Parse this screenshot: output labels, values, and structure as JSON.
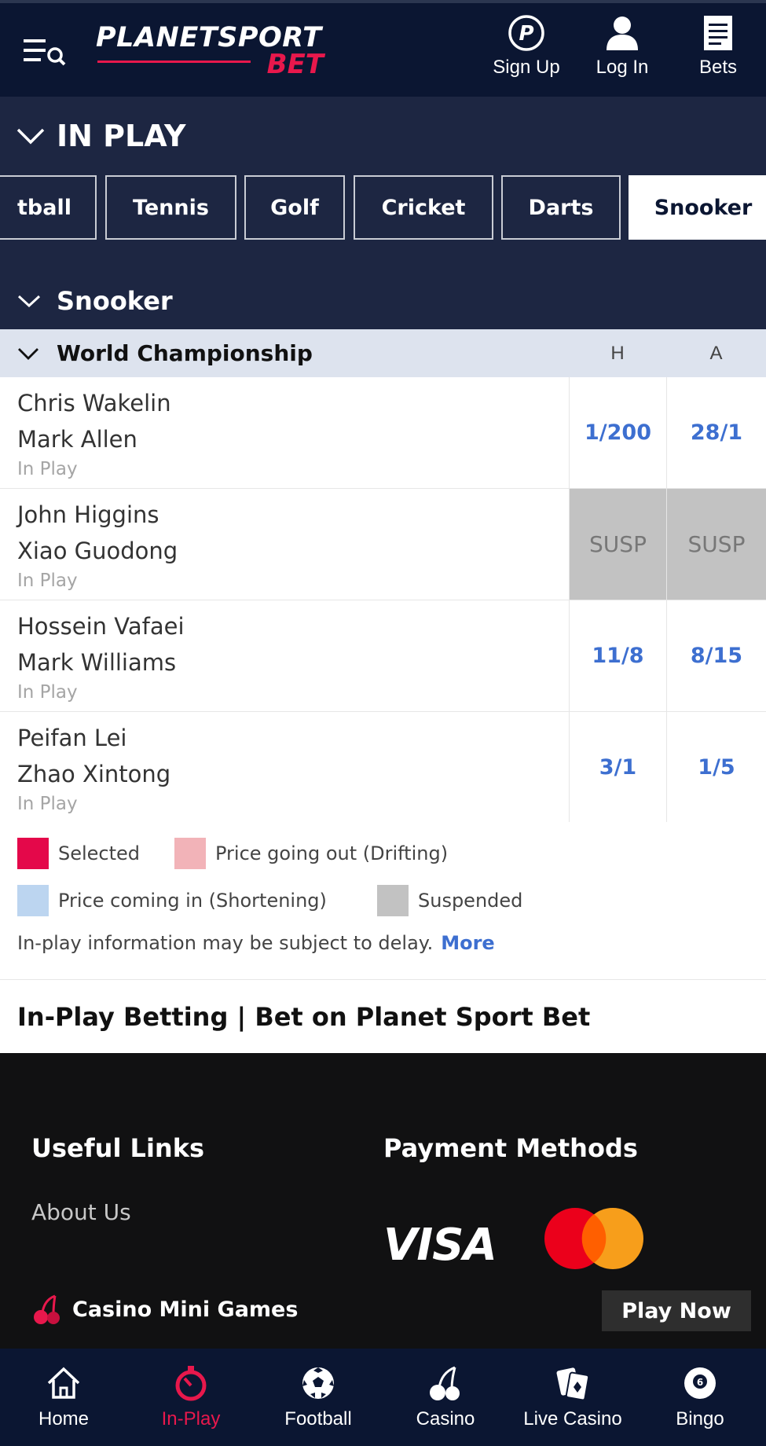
{
  "brand": {
    "name_line1": "PLANETSPORT",
    "name_line2": "BET",
    "accent": "#e8184c",
    "navy": "#0b1632"
  },
  "header": {
    "menu_icon": "menu-search-icon",
    "sign_up": "Sign Up",
    "log_in": "Log In",
    "bets": "Bets"
  },
  "inplay": {
    "title": "IN PLAY",
    "tabs": [
      "tball",
      "Tennis",
      "Golf",
      "Cricket",
      "Darts",
      "Snooker"
    ],
    "active_tab": "Snooker"
  },
  "sport_section": {
    "title": "Snooker"
  },
  "competition": {
    "title": "World Championship",
    "col_home": "H",
    "col_away": "A"
  },
  "matches": [
    {
      "home": "Chris Wakelin",
      "away": "Mark Allen",
      "status": "In Play",
      "odds_h": "1/200",
      "odds_a": "28/1",
      "suspended": false
    },
    {
      "home": "John Higgins",
      "away": "Xiao Guodong",
      "status": "In Play",
      "odds_h": "SUSP",
      "odds_a": "SUSP",
      "suspended": true
    },
    {
      "home": "Hossein Vafaei",
      "away": "Mark Williams",
      "status": "In Play",
      "odds_h": "11/8",
      "odds_a": "8/15",
      "suspended": false
    },
    {
      "home": "Peifan Lei",
      "away": "Zhao Xintong",
      "status": "In Play",
      "odds_h": "3/1",
      "odds_a": "1/5",
      "suspended": false
    }
  ],
  "legend": {
    "selected": "Selected",
    "drifting": "Price going out (Drifting)",
    "shortening": "Price coming in (Shortening)",
    "suspended": "Suspended",
    "colors": {
      "selected": "#e4084a",
      "drifting": "#f2b3b8",
      "shortening": "#bcd5f0",
      "suspended": "#c2c2c2"
    },
    "delay_note": "In-play information may be subject to delay.",
    "more": "More"
  },
  "seo_title": "In-Play Betting | Bet on Planet Sport Bet",
  "footer": {
    "useful_links": "Useful Links",
    "about_us": "About Us",
    "payment_methods": "Payment Methods",
    "visa": "VISA",
    "casino_mini_games": "Casino Mini Games",
    "play_now": "Play Now"
  },
  "bottom_nav": {
    "home": "Home",
    "in_play": "In-Play",
    "football": "Football",
    "casino": "Casino",
    "live_casino": "Live Casino",
    "bingo": "Bingo",
    "active": "In-Play"
  }
}
